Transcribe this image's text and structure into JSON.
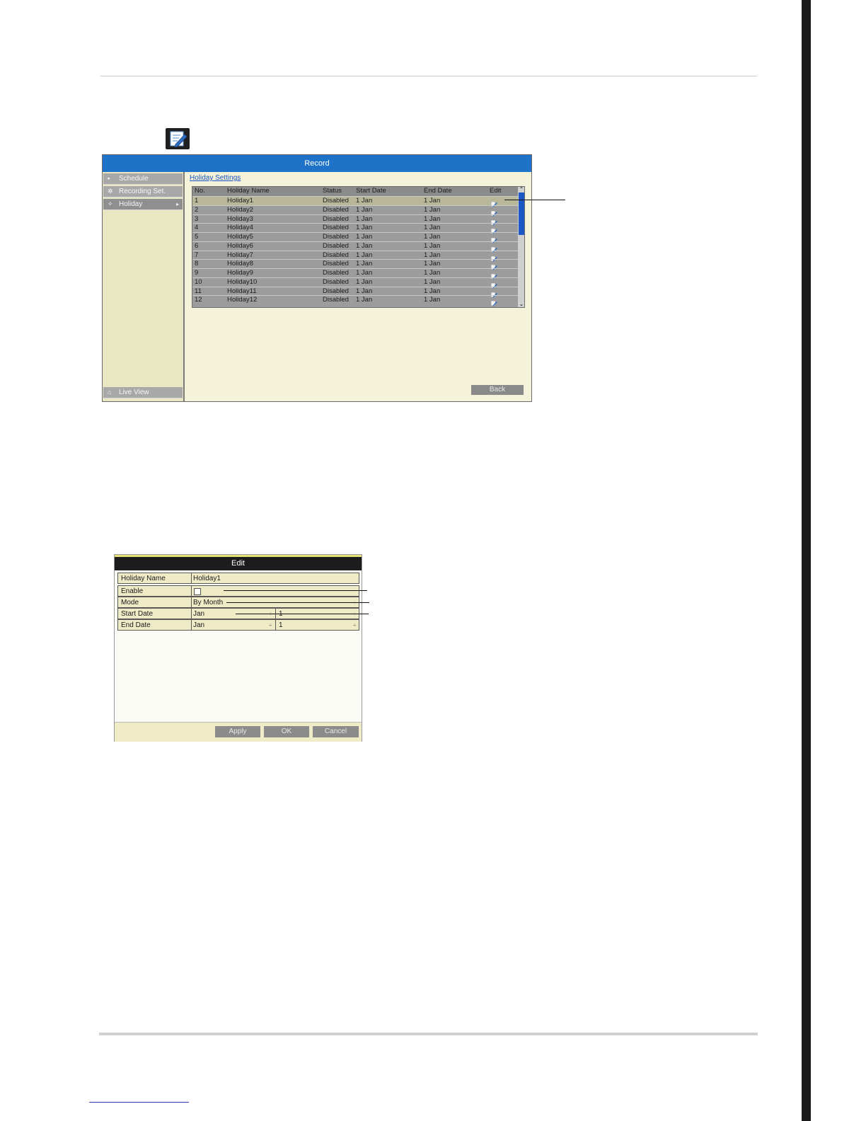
{
  "record_window": {
    "title": "Record",
    "sidebar": {
      "items": [
        {
          "label": "Schedule",
          "icon": "calendar-icon",
          "glyph": "▪"
        },
        {
          "label": "Recording Set.",
          "icon": "gear-icon",
          "glyph": "✲"
        },
        {
          "label": "Holiday",
          "icon": "holiday-icon",
          "glyph": "✧",
          "active": true,
          "chevron": "▸"
        }
      ],
      "bottom_item": {
        "label": "Live View",
        "icon": "home-icon",
        "glyph": "⌂"
      }
    },
    "section_title": "Holiday Settings",
    "columns": [
      "No.",
      "Holiday Name",
      "Status",
      "Start Date",
      "End Date",
      "Edit"
    ],
    "rows": [
      {
        "no": "1",
        "name": "Holiday1",
        "status": "Disabled",
        "start": "1 Jan",
        "end": "1 Jan"
      },
      {
        "no": "2",
        "name": "Holiday2",
        "status": "Disabled",
        "start": "1 Jan",
        "end": "1 Jan"
      },
      {
        "no": "3",
        "name": "Holiday3",
        "status": "Disabled",
        "start": "1 Jan",
        "end": "1 Jan"
      },
      {
        "no": "4",
        "name": "Holiday4",
        "status": "Disabled",
        "start": "1 Jan",
        "end": "1 Jan"
      },
      {
        "no": "5",
        "name": "Holiday5",
        "status": "Disabled",
        "start": "1 Jan",
        "end": "1 Jan"
      },
      {
        "no": "6",
        "name": "Holiday6",
        "status": "Disabled",
        "start": "1 Jan",
        "end": "1 Jan"
      },
      {
        "no": "7",
        "name": "Holiday7",
        "status": "Disabled",
        "start": "1 Jan",
        "end": "1 Jan"
      },
      {
        "no": "8",
        "name": "Holiday8",
        "status": "Disabled",
        "start": "1 Jan",
        "end": "1 Jan"
      },
      {
        "no": "9",
        "name": "Holiday9",
        "status": "Disabled",
        "start": "1 Jan",
        "end": "1 Jan"
      },
      {
        "no": "10",
        "name": "Holiday10",
        "status": "Disabled",
        "start": "1 Jan",
        "end": "1 Jan"
      },
      {
        "no": "11",
        "name": "Holiday11",
        "status": "Disabled",
        "start": "1 Jan",
        "end": "1 Jan"
      },
      {
        "no": "12",
        "name": "Holiday12",
        "status": "Disabled",
        "start": "1 Jan",
        "end": "1 Jan"
      }
    ],
    "selected_row": 1,
    "back_button": "Back",
    "scroll_up": "⌃",
    "scroll_down": "⌄"
  },
  "edit_dialog": {
    "title": "Edit",
    "holiday_name_label": "Holiday Name",
    "holiday_name_value": "Holiday1",
    "enable_label": "Enable",
    "enable_checked": false,
    "mode_label": "Mode",
    "mode_value": "By Month",
    "start_date_label": "Start Date",
    "start_month": "Jan",
    "start_day": "1",
    "end_date_label": "End Date",
    "end_month": "Jan",
    "end_day": "1",
    "dropdown_arrow": "÷",
    "apply_button": "Apply",
    "ok_button": "OK",
    "cancel_button": "Cancel"
  },
  "colors": {
    "title_bar": "#1e73c8",
    "panel_bg": "#f4f2d8",
    "grid_bg": "#9c9c9c",
    "selected_row": "#b8b79a",
    "link": "#1a52c2"
  }
}
